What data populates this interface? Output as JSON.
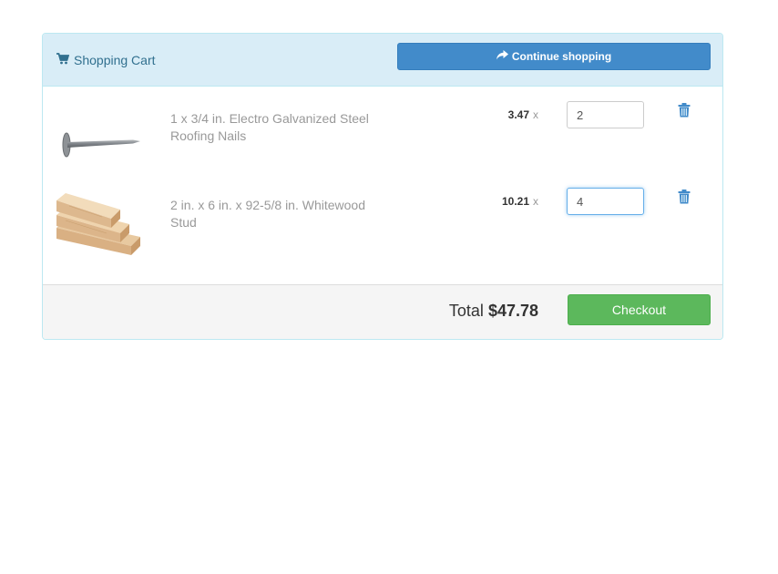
{
  "cart": {
    "title": "Shopping Cart",
    "continue_label": "Continue shopping",
    "items": [
      {
        "name": "1 x 3/4 in. Electro Galvanized Steel Roofing Nails",
        "price": "3.47",
        "multiplier": "x",
        "quantity": "2",
        "image_icon": "roofing-nail"
      },
      {
        "name": "2 in. x 6 in. x 92-5/8 in. Whitewood Stud",
        "price": "10.21",
        "multiplier": "x",
        "quantity": "4",
        "image_icon": "wood-stud"
      }
    ],
    "total_label": "Total",
    "total_amount": "$47.78",
    "checkout_label": "Checkout"
  },
  "colors": {
    "heading_bg": "#d9edf7",
    "heading_text": "#31708f",
    "primary_button": "#428bca",
    "checkout_button": "#5cb85c",
    "footer_bg": "#f5f5f5"
  }
}
